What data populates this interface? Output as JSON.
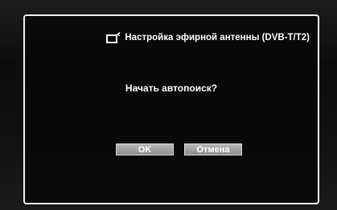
{
  "dialog": {
    "title": "Настройка эфирной антенны (DVB-T/T2)",
    "title_icon": "tv-antenna-icon",
    "prompt": "Начать автопоиск?",
    "buttons": {
      "ok_label": "OK",
      "cancel_label": "Отмена"
    }
  },
  "colors": {
    "background": "#0f0f0f",
    "dialog_border": "#f2f2f2",
    "button_fill": "#a0a0a0",
    "text": "#ffffff"
  }
}
